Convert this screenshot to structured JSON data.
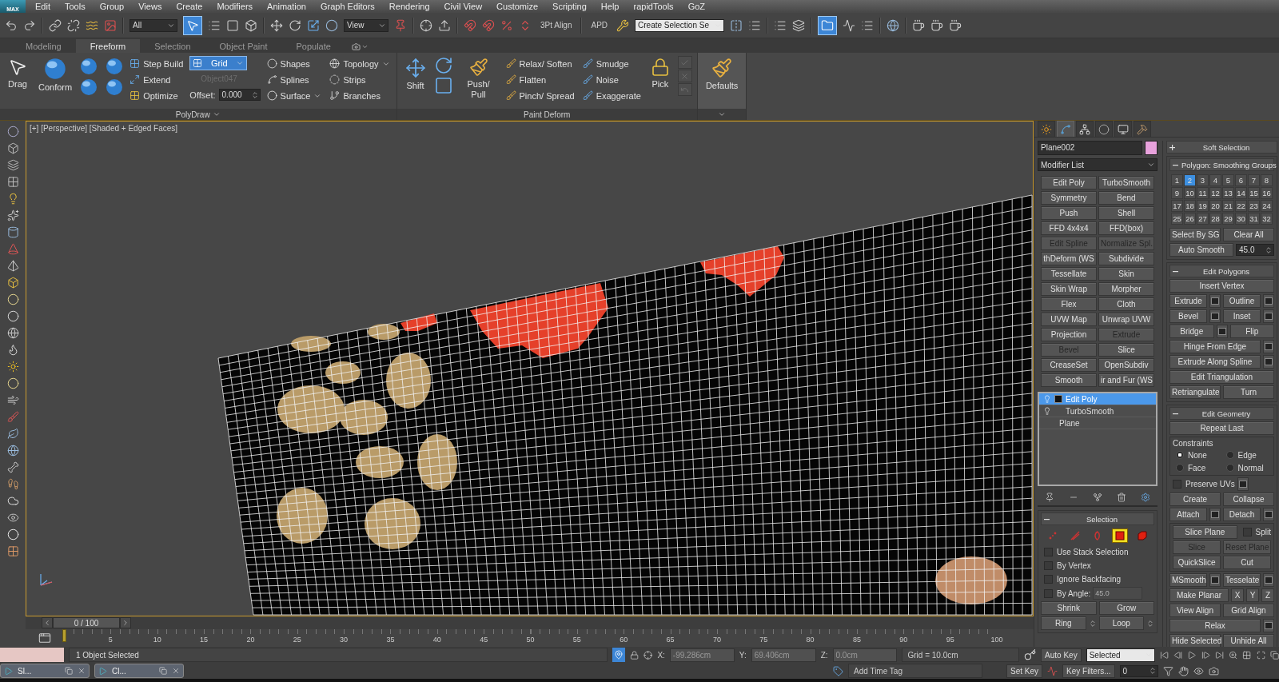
{
  "app_button": "MAX",
  "menu": [
    "Edit",
    "Tools",
    "Group",
    "Views",
    "Create",
    "Modifiers",
    "Animation",
    "Graph Editors",
    "Rendering",
    "Civil View",
    "Customize",
    "Scripting",
    "Help",
    "rapidTools",
    "GoZ"
  ],
  "toolbar": {
    "selection_filter": "All",
    "reference_coord": "View",
    "align_label": "3Pt Align",
    "apd_label": "APD",
    "named_selection": "Create Selection Se"
  },
  "ribbon_tabs": [
    {
      "label": "Modeling",
      "selected": false
    },
    {
      "label": "Freeform",
      "selected": true
    },
    {
      "label": "Selection",
      "selected": false
    },
    {
      "label": "Object Paint",
      "selected": false
    },
    {
      "label": "Populate",
      "selected": false
    }
  ],
  "polydraw": {
    "drag": "Drag",
    "conform": "Conform",
    "step_build": "Step Build",
    "extend": "Extend",
    "optimize": "Optimize",
    "grid": "Grid",
    "object": "Object047",
    "offset_label": "Offset:",
    "offset_value": "0.000",
    "shapes": "Shapes",
    "splines": "Splines",
    "surface": "Surface",
    "topology": "Topology",
    "strips": "Strips",
    "branches": "Branches",
    "group_label": "PolyDraw"
  },
  "paint_deform": {
    "shift": "Shift",
    "push_pull": "Push/ Pull",
    "tools": [
      "Relax/ Soften",
      "Flatten",
      "Pinch/ Spread",
      "Smudge",
      "Noise",
      "Exaggerate"
    ],
    "pick": "Pick",
    "group_label": "Paint Deform"
  },
  "defaults": "Defaults",
  "viewport": {
    "label": "[+] [Perspective] [Shaded + Edged Faces]"
  },
  "command_panel": {
    "tabs": [
      {
        "selected": false
      },
      {
        "selected": true
      },
      {
        "selected": false
      },
      {
        "selected": false
      },
      {
        "selected": false
      },
      {
        "selected": false
      }
    ],
    "object_name": "Plane002",
    "color": "#e8a2dc",
    "modifier_list": "Modifier List",
    "modifiers": [
      {
        "label": "Edit Poly",
        "disabled": false
      },
      {
        "label": "TurboSmooth",
        "disabled": false
      },
      {
        "label": "Symmetry",
        "disabled": false
      },
      {
        "label": "Bend",
        "disabled": false
      },
      {
        "label": "Push",
        "disabled": false
      },
      {
        "label": "Shell",
        "disabled": false
      },
      {
        "label": "FFD 4x4x4",
        "disabled": false
      },
      {
        "label": "FFD(box)",
        "disabled": false
      },
      {
        "label": "Edit Spline",
        "disabled": true
      },
      {
        "label": "Normalize Spl.",
        "disabled": true
      },
      {
        "label": "thDeform (WS",
        "disabled": false
      },
      {
        "label": "Subdivide",
        "disabled": false
      },
      {
        "label": "Tessellate",
        "disabled": false
      },
      {
        "label": "Skin",
        "disabled": false
      },
      {
        "label": "Skin Wrap",
        "disabled": false
      },
      {
        "label": "Morpher",
        "disabled": false
      },
      {
        "label": "Flex",
        "disabled": false
      },
      {
        "label": "Cloth",
        "disabled": false
      },
      {
        "label": "UVW Map",
        "disabled": false
      },
      {
        "label": "Unwrap UVW",
        "disabled": false
      },
      {
        "label": "Projection",
        "disabled": false
      },
      {
        "label": "Extrude",
        "disabled": true
      },
      {
        "label": "Bevel",
        "disabled": true
      },
      {
        "label": "Slice",
        "disabled": false
      },
      {
        "label": "CreaseSet",
        "disabled": false
      },
      {
        "label": "OpenSubdiv",
        "disabled": false
      },
      {
        "label": "Smooth",
        "disabled": false
      },
      {
        "label": "ir and Fur (WS",
        "disabled": false
      }
    ],
    "stack": [
      {
        "label": "Edit Poly",
        "kind": "modifier",
        "selected": true,
        "expandable": true
      },
      {
        "label": "TurboSmooth",
        "kind": "modifier",
        "selected": false,
        "expandable": false
      },
      {
        "label": "Plane",
        "kind": "base",
        "selected": false,
        "expandable": false
      }
    ],
    "selection": {
      "title": "Selection",
      "expanded": true,
      "subobjects": [
        {
          "selected": false
        },
        {
          "selected": false
        },
        {
          "selected": false
        },
        {
          "selected": true
        },
        {
          "selected": false
        }
      ],
      "options": [
        {
          "label": "Use Stack Selection",
          "checked": false
        },
        {
          "label": "By Vertex",
          "checked": false
        },
        {
          "label": "Ignore Backfacing",
          "checked": false
        }
      ],
      "by_angle": {
        "label": "By Angle:",
        "checked": false,
        "value": "45.0"
      },
      "buttons": [
        "Shrink",
        "Grow"
      ],
      "loops": [
        "Ring",
        "Loop"
      ]
    }
  },
  "rollouts": {
    "soft_selection": {
      "title": "Soft Selection",
      "expanded": false
    },
    "smoothing_groups": {
      "title": "Polygon: Smoothing Groups",
      "expanded": true,
      "groups": [
        {
          "label": "1",
          "selected": false
        },
        {
          "label": "2",
          "selected": true
        },
        {
          "label": "3",
          "selected": false
        },
        {
          "label": "4",
          "selected": false
        },
        {
          "label": "5",
          "selected": false
        },
        {
          "label": "6",
          "selected": false
        },
        {
          "label": "7",
          "selected": false
        },
        {
          "label": "8",
          "selected": false
        },
        {
          "label": "9",
          "selected": false
        },
        {
          "label": "10",
          "selected": false
        },
        {
          "label": "11",
          "selected": false
        },
        {
          "label": "12",
          "selected": false
        },
        {
          "label": "13",
          "selected": false
        },
        {
          "label": "14",
          "selected": false
        },
        {
          "label": "15",
          "selected": false
        },
        {
          "label": "16",
          "selected": false
        },
        {
          "label": "17",
          "selected": false
        },
        {
          "label": "18",
          "selected": false
        },
        {
          "label": "19",
          "selected": false
        },
        {
          "label": "20",
          "selected": false
        },
        {
          "label": "21",
          "selected": false
        },
        {
          "label": "22",
          "selected": false
        },
        {
          "label": "23",
          "selected": false
        },
        {
          "label": "24",
          "selected": false
        },
        {
          "label": "25",
          "selected": false
        },
        {
          "label": "26",
          "selected": false
        },
        {
          "label": "27",
          "selected": false
        },
        {
          "label": "28",
          "selected": false
        },
        {
          "label": "29",
          "selected": false
        },
        {
          "label": "30",
          "selected": false
        },
        {
          "label": "31",
          "selected": false
        },
        {
          "label": "32",
          "selected": false
        }
      ],
      "select_by": "Select By SG",
      "clear": "Clear All",
      "auto_smooth": "Auto Smooth",
      "threshold": "45.0"
    },
    "edit_polygons": {
      "title": "Edit Polygons",
      "expanded": true,
      "rows": [
        [
          {
            "kind": "button",
            "label": "Insert Vertex"
          }
        ],
        [
          {
            "kind": "button",
            "label": "Extrude"
          },
          {
            "kind": "square"
          },
          {
            "kind": "button",
            "label": "Outline"
          },
          {
            "kind": "square"
          }
        ],
        [
          {
            "kind": "button",
            "label": "Bevel"
          },
          {
            "kind": "square"
          },
          {
            "kind": "button",
            "label": "Inset"
          },
          {
            "kind": "square"
          }
        ],
        [
          {
            "kind": "button",
            "label": "Bridge"
          },
          {
            "kind": "square"
          },
          {
            "kind": "button",
            "label": "Flip"
          }
        ],
        [
          {
            "kind": "button",
            "label": "Hinge From Edge"
          },
          {
            "kind": "square"
          }
        ],
        [
          {
            "kind": "button",
            "label": "Extrude Along Spline"
          },
          {
            "kind": "square"
          }
        ],
        [
          {
            "kind": "button",
            "label": "Edit Triangulation"
          }
        ],
        [
          {
            "kind": "button",
            "label": "Retriangulate"
          },
          {
            "kind": "button",
            "label": "Turn"
          }
        ]
      ]
    },
    "edit_geometry": {
      "title": "Edit Geometry",
      "expanded": true,
      "repeat": "Repeat Last",
      "constraints": {
        "title": "Constraints",
        "options": [
          {
            "label": "None",
            "selected": true
          },
          {
            "label": "Edge",
            "selected": false
          },
          {
            "label": "Face",
            "selected": false
          },
          {
            "label": "Normal",
            "selected": false
          }
        ]
      },
      "rows": [
        [
          {
            "kind": "check",
            "label": "Preserve UVs",
            "checked": false
          },
          {
            "kind": "square"
          }
        ],
        [
          {
            "kind": "button",
            "label": "Create",
            "disabled": false
          },
          {
            "kind": "button",
            "label": "Collapse",
            "disabled": false
          }
        ],
        [
          {
            "kind": "button",
            "label": "Attach",
            "disabled": false
          },
          {
            "kind": "square"
          },
          {
            "kind": "button",
            "label": "Detach",
            "disabled": false
          },
          {
            "kind": "square"
          }
        ]
      ],
      "slice_rows": [
        [
          {
            "kind": "button",
            "label": "Slice Plane",
            "disabled": false
          },
          {
            "kind": "check",
            "label": "Split",
            "checked": false
          }
        ],
        [
          {
            "kind": "button",
            "label": "Slice",
            "disabled": true
          },
          {
            "kind": "button",
            "label": "Reset Plane",
            "disabled": true
          }
        ],
        [
          {
            "kind": "button",
            "label": "QuickSlice",
            "disabled": false
          },
          {
            "kind": "button",
            "label": "Cut",
            "disabled": false
          }
        ]
      ],
      "more_rows": [
        [
          {
            "kind": "button",
            "label": "MSmooth",
            "disabled": false
          },
          {
            "kind": "square"
          },
          {
            "kind": "button",
            "label": "Tesselate",
            "disabled": false
          },
          {
            "kind": "square"
          }
        ],
        [
          {
            "kind": "button",
            "label": "Make Planar",
            "disabled": false
          },
          {
            "kind": "axis",
            "label": "X"
          },
          {
            "kind": "axis",
            "label": "Y"
          },
          {
            "kind": "axis",
            "label": "Z"
          }
        ],
        [
          {
            "kind": "button",
            "label": "View Align",
            "disabled": false
          },
          {
            "kind": "button",
            "label": "Grid Align",
            "disabled": false
          }
        ],
        [
          {
            "kind": "button",
            "label": "Relax",
            "disabled": false
          },
          {
            "kind": "square"
          }
        ],
        [
          {
            "kind": "button",
            "label": "Hide Selected",
            "disabled": false
          },
          {
            "kind": "button",
            "label": "Unhide All",
            "disabled": false
          }
        ]
      ]
    }
  },
  "timeline": {
    "frame": "0 / 100",
    "ticks": [
      "5",
      "10",
      "15",
      "20",
      "25",
      "30",
      "35",
      "40",
      "45",
      "50",
      "55",
      "60",
      "65",
      "70",
      "75",
      "80",
      "85",
      "90",
      "95",
      "100"
    ]
  },
  "status": {
    "selection": "1 Object Selected",
    "x_label": "X:",
    "x": "-99.286cm",
    "y_label": "Y:",
    "y": "69.406cm",
    "z_label": "Z:",
    "z": "0.0cm",
    "grid": "Grid = 10.0cm",
    "time_tag": "Add Time Tag",
    "auto_key": "Auto Key",
    "key_mode": "Selected",
    "set_key": "Set Key",
    "key_filters": "Key Filters...",
    "frame": "0"
  },
  "taskbar": [
    {
      "label": "Sl..."
    },
    {
      "label": "Cl..."
    }
  ]
}
